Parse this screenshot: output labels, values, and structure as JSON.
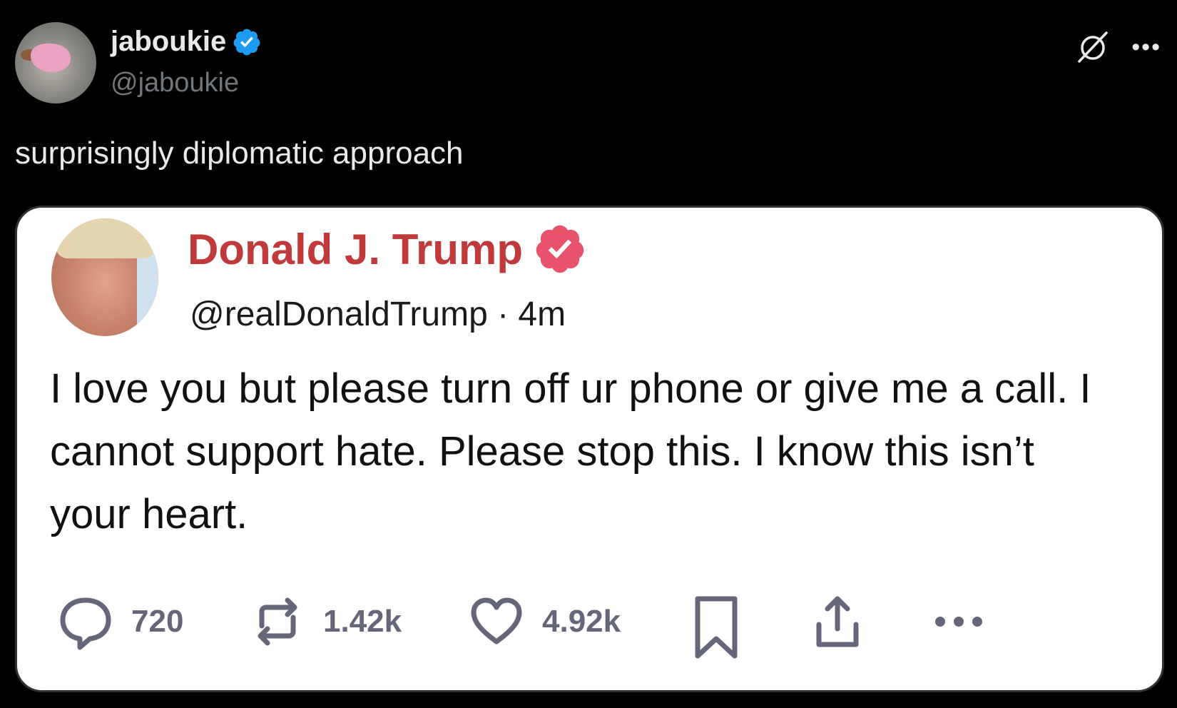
{
  "author": {
    "name": "jaboukie",
    "handle": "@jaboukie",
    "verified_color": "#1d9bf0",
    "avatar_icon": "profile-photo"
  },
  "top_actions": {
    "grok_icon": "grok-icon",
    "more_icon": "more-horizontal-icon"
  },
  "post": {
    "text": "surprisingly diplomatic approach"
  },
  "embedded": {
    "name": "Donald J. Trump",
    "handle_line": "@realDonaldTrump · 4m",
    "name_color": "#c0393b",
    "badge_color": "#e8526a",
    "body": "I love you but please turn off ur phone or give me a call. I cannot support hate. Please stop this. I know this isn’t your heart.",
    "actions": {
      "replies": "720",
      "retweets": "1.42k",
      "likes": "4.92k"
    }
  }
}
